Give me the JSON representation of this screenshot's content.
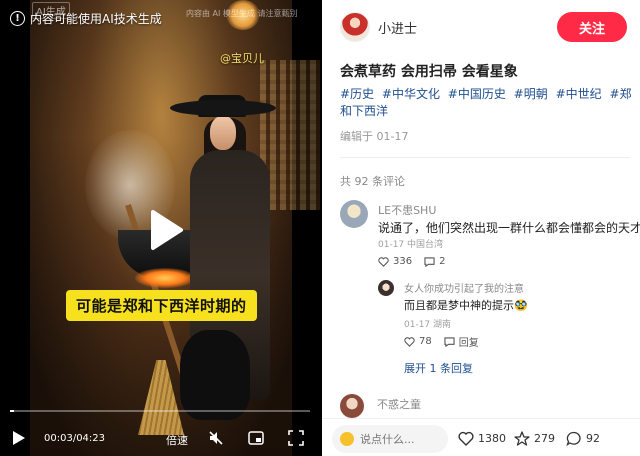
{
  "video": {
    "ai_badge": "AI生成",
    "ai_notice": "内容可能使用AI技术生成",
    "watermark_top": "内容由 AI 模型生成 请注意甄别",
    "watermark_author": "@宝贝儿",
    "caption": "可能是郑和下西洋时期的",
    "progress": 0.012,
    "time": "00:03/04:23",
    "speed_label": "倍速"
  },
  "post": {
    "author": "小进士",
    "follow_label": "关注",
    "title": "会煮草药 会用扫帚 会看星象",
    "tags": [
      "#历史",
      "#中华文化",
      "#中国历史",
      "#明朝",
      "#中世纪",
      "#郑和下西洋"
    ],
    "edit_date": "编辑于 01-17",
    "comment_count": "共 92 条评论"
  },
  "comments": [
    {
      "name": "LE不患SHU",
      "text": "说通了，他们突然出现一群什么都会懂都会的天才",
      "meta": "01-17 中国台湾",
      "likes": "336",
      "replies": "2"
    }
  ],
  "reply": {
    "name": "女人你成功引起了我的注意",
    "text": "而且都是梦中神的提示🥸",
    "meta": "01-17 湖南",
    "likes": "78",
    "reply_label": "回复"
  },
  "expand_replies": "展开 1 条回复",
  "comment2": {
    "name": "不惑之童"
  },
  "bottom": {
    "input_placeholder": "说点什么...",
    "likes": "1380",
    "favorites": "279",
    "comments": "92"
  },
  "colors": {
    "follow": "#ff2a45",
    "tag": "#1f4f8f",
    "caption_bg": "#f7e11e"
  }
}
